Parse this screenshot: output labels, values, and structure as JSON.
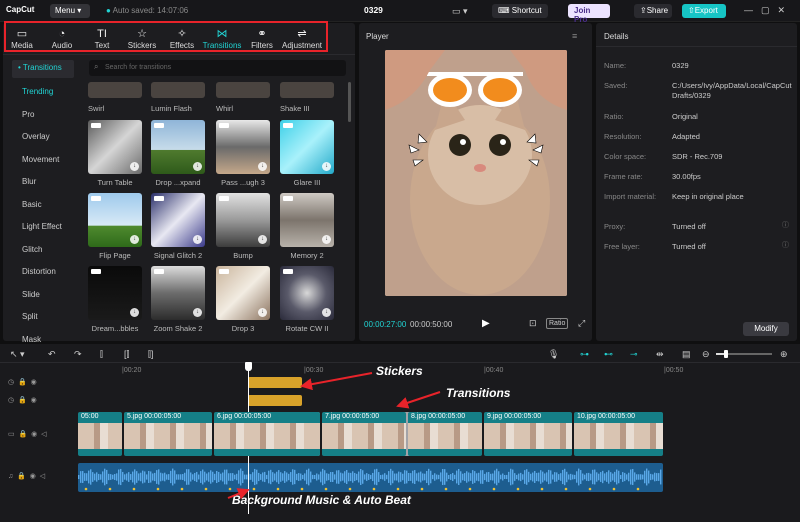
{
  "topbar": {
    "logo": "CapCut",
    "menu": "Menu",
    "autosave": "Auto saved: 14:07:06",
    "project": "0329",
    "shortcut": "Shortcut",
    "join_pro": "Join Pro",
    "share": "Share",
    "export": "Export"
  },
  "toolbar": [
    {
      "label": "Media",
      "icon": "media-icon",
      "glyph": "▭"
    },
    {
      "label": "Audio",
      "icon": "audio-icon",
      "glyph": "◔"
    },
    {
      "label": "Text",
      "icon": "text-icon",
      "glyph": "TI"
    },
    {
      "label": "Stickers",
      "icon": "stickers-icon",
      "glyph": "☆"
    },
    {
      "label": "Effects",
      "icon": "effects-icon",
      "glyph": "✧"
    },
    {
      "label": "Transitions",
      "icon": "transitions-icon",
      "glyph": "⋈"
    },
    {
      "label": "Filters",
      "icon": "filters-icon",
      "glyph": "⚭"
    },
    {
      "label": "Adjustment",
      "icon": "adjustment-icon",
      "glyph": "⇌"
    }
  ],
  "categories": {
    "header": "• Transitions",
    "items": [
      "Trending",
      "Pro",
      "Overlay",
      "Movement",
      "Blur",
      "Basic",
      "Light Effect",
      "Glitch",
      "Distortion",
      "Slide",
      "Split",
      "Mask"
    ]
  },
  "search_placeholder": "Search for transitions",
  "top_row_labels": [
    "Swirl",
    "Lumin Flash",
    "Whirl",
    "Shake III"
  ],
  "thumbs": [
    {
      "label": "Turn Table"
    },
    {
      "label": "Drop ...xpand"
    },
    {
      "label": "Pass ...ugh 3"
    },
    {
      "label": "Glare III"
    },
    {
      "label": "Flip Page"
    },
    {
      "label": "Signal Glitch 2"
    },
    {
      "label": "Bump"
    },
    {
      "label": "Memory 2"
    },
    {
      "label": "Dream...bbles"
    },
    {
      "label": "Zoom Shake 2"
    },
    {
      "label": "Drop 3"
    },
    {
      "label": "Rotate CW II"
    }
  ],
  "player": {
    "title": "Player",
    "current": "00:00:27:00",
    "total": "00:00:50:00",
    "ratio": "Ratio"
  },
  "details": {
    "title": "Details",
    "rows": [
      {
        "k": "Name:",
        "v": "0329"
      },
      {
        "k": "Saved:",
        "v": "C:/Users/Ivy/AppData/Local/CapCut Drafts/0329"
      },
      {
        "k": "Ratio:",
        "v": "Original"
      },
      {
        "k": "Resolution:",
        "v": "Adapted"
      },
      {
        "k": "Color space:",
        "v": "SDR - Rec.709"
      },
      {
        "k": "Frame rate:",
        "v": "30.00fps"
      },
      {
        "k": "Import material:",
        "v": "Keep in original place"
      },
      {
        "k": "Proxy:",
        "v": "Turned off"
      },
      {
        "k": "Free layer:",
        "v": "Turned off"
      }
    ],
    "modify": "Modify"
  },
  "timeline": {
    "ruler": [
      "|00:20",
      "|00:30",
      "|00:40",
      "|00:50"
    ],
    "clips": [
      {
        "label": "05:00"
      },
      {
        "label": "5.jpg   00:00:05:00"
      },
      {
        "label": "6.jpg   00:00:05:00"
      },
      {
        "label": "7.jpg   00:00:05:00"
      },
      {
        "label": "8.jpg   00:00:05:00"
      },
      {
        "label": "9.jpg   00:00:05:00"
      },
      {
        "label": "10.jpg   00:00:05:00"
      }
    ]
  },
  "annotations": {
    "stickers": "Stickers",
    "transitions": "Transitions",
    "music": "Background Music & Auto Beat"
  },
  "colors": {
    "accent": "#21d4d4",
    "annotation_box": "#e8232a",
    "clip": "#157f87",
    "audio": "#1d5d8f",
    "sticker": "#d8a22a"
  }
}
